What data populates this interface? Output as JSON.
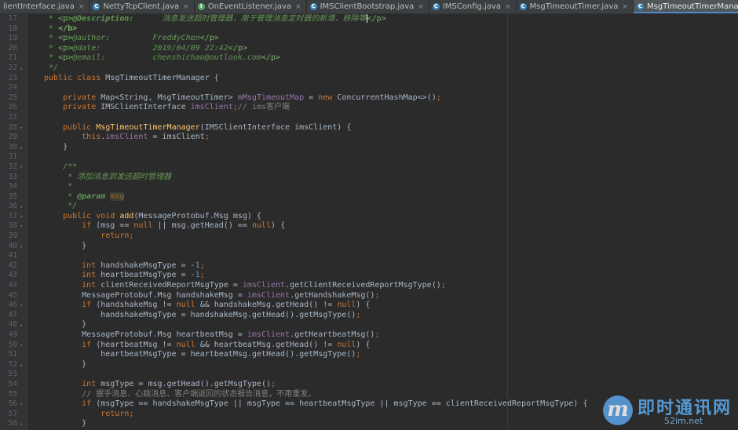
{
  "tabs": [
    {
      "label": "lientInterface.java",
      "icon": "none",
      "active": false
    },
    {
      "label": "NettyTcpClient.java",
      "icon": "class-icon",
      "active": false
    },
    {
      "label": "OnEventListener.java",
      "icon": "interface-icon",
      "active": false
    },
    {
      "label": "IMSClientBootstrap.java",
      "icon": "class-icon",
      "active": false
    },
    {
      "label": "IMSConfig.java",
      "icon": "class-icon",
      "active": false
    },
    {
      "label": "MsgTimeoutTimer.java",
      "icon": "class-icon",
      "active": false
    },
    {
      "label": "MsgTimeoutTimerManager.java",
      "icon": "class-icon",
      "active": true
    }
  ],
  "colors": {
    "background": "#2b2b2b",
    "keyword": "#cc7832",
    "field": "#9876aa",
    "method": "#ffc66d",
    "number": "#6897bb",
    "doc": "#629755",
    "tab_active_underline": "#4a88c7"
  },
  "editor": {
    "lines": [
      {
        "n": "17",
        "fold": "",
        "t": [
          [
            "dc",
            " * "
          ],
          [
            "tg",
            "<p>"
          ],
          [
            "ta",
            "@Description:"
          ],
          [
            "dc",
            "      消息发送超时管理器，用于管理消息定时器的新增、移除等"
          ],
          [
            "caret",
            ""
          ],
          [
            "tg",
            "</p>"
          ]
        ]
      },
      {
        "n": "18",
        "fold": "",
        "t": [
          [
            "dc",
            " * "
          ],
          [
            "tg2",
            "</b>"
          ]
        ]
      },
      {
        "n": "19",
        "fold": "",
        "t": [
          [
            "dc",
            " * "
          ],
          [
            "tg",
            "<p>"
          ],
          [
            "dc",
            "@author:         FreddyChen"
          ],
          [
            "tg",
            "</p>"
          ]
        ]
      },
      {
        "n": "20",
        "fold": "",
        "t": [
          [
            "dc",
            " * "
          ],
          [
            "tg",
            "<p>"
          ],
          [
            "dc",
            "@date:           2019/04/09 22:42"
          ],
          [
            "tg",
            "</p>"
          ]
        ]
      },
      {
        "n": "21",
        "fold": "",
        "t": [
          [
            "dc",
            " * "
          ],
          [
            "tg",
            "<p>"
          ],
          [
            "dc",
            "@email:          chenshichao@outlook.com"
          ],
          [
            "tg",
            "</p>"
          ]
        ]
      },
      {
        "n": "22",
        "fold": "▴",
        "t": [
          [
            "dc",
            " */"
          ]
        ]
      },
      {
        "n": "23",
        "fold": "",
        "t": [
          [
            "kw",
            "public class "
          ],
          [
            "tx",
            "MsgTimeoutTimerManager {"
          ]
        ]
      },
      {
        "n": "24",
        "fold": "",
        "t": []
      },
      {
        "n": "25",
        "fold": "",
        "t": [
          [
            "kw",
            "    private "
          ],
          [
            "tx",
            "Map<String, MsgTimeoutTimer> "
          ],
          [
            "fd",
            "mMsgTimeoutMap"
          ],
          [
            "tx",
            " = "
          ],
          [
            "kw",
            "new "
          ],
          [
            "tx",
            "ConcurrentHashMap<>()"
          ],
          [
            "kw",
            ";"
          ]
        ]
      },
      {
        "n": "26",
        "fold": "",
        "t": [
          [
            "kw",
            "    private "
          ],
          [
            "tx",
            "IMSClientInterface "
          ],
          [
            "fd",
            "imsClient"
          ],
          [
            "kw",
            ";"
          ],
          [
            "cm",
            "// ims客户端"
          ]
        ]
      },
      {
        "n": "27",
        "fold": "",
        "t": []
      },
      {
        "n": "28",
        "fold": "▾",
        "t": [
          [
            "kw",
            "    public "
          ],
          [
            "fn",
            "MsgTimeoutTimerManager"
          ],
          [
            "tx",
            "(IMSClientInterface imsClient) {"
          ]
        ]
      },
      {
        "n": "29",
        "fold": "",
        "t": [
          [
            "kw",
            "        this"
          ],
          [
            "tx",
            "."
          ],
          [
            "fd",
            "imsClient"
          ],
          [
            "tx",
            " = imsClient"
          ],
          [
            "kw",
            ";"
          ]
        ]
      },
      {
        "n": "30",
        "fold": "▴",
        "t": [
          [
            "tx",
            "    }"
          ]
        ]
      },
      {
        "n": "31",
        "fold": "",
        "t": []
      },
      {
        "n": "32",
        "fold": "▾",
        "t": [
          [
            "dc",
            "    /**"
          ]
        ]
      },
      {
        "n": "33",
        "fold": "",
        "t": [
          [
            "dc",
            "     * 添加消息到发送超时管理器"
          ]
        ]
      },
      {
        "n": "34",
        "fold": "",
        "t": [
          [
            "dc",
            "     *"
          ]
        ]
      },
      {
        "n": "35",
        "fold": "",
        "t": [
          [
            "dc",
            "     * "
          ],
          [
            "ta",
            "@param "
          ],
          [
            "pm",
            "msg"
          ]
        ]
      },
      {
        "n": "36",
        "fold": "▴",
        "t": [
          [
            "dc",
            "     */"
          ]
        ]
      },
      {
        "n": "37",
        "fold": "▾",
        "t": [
          [
            "kw",
            "    public void "
          ],
          [
            "fn",
            "add"
          ],
          [
            "tx",
            "(MessageProtobuf.Msg msg) {"
          ]
        ]
      },
      {
        "n": "38",
        "fold": "▾",
        "t": [
          [
            "kw",
            "        if "
          ],
          [
            "tx",
            "(msg == "
          ],
          [
            "kw",
            "null "
          ],
          [
            "tx",
            "|| msg.getHead() == "
          ],
          [
            "kw",
            "null"
          ],
          [
            "tx",
            ") {"
          ]
        ]
      },
      {
        "n": "39",
        "fold": "",
        "t": [
          [
            "kw",
            "            return;"
          ]
        ]
      },
      {
        "n": "40",
        "fold": "▴",
        "t": [
          [
            "tx",
            "        }"
          ]
        ]
      },
      {
        "n": "41",
        "fold": "",
        "t": []
      },
      {
        "n": "42",
        "fold": "",
        "t": [
          [
            "kw",
            "        int "
          ],
          [
            "tx",
            "handshakeMsgType = -"
          ],
          [
            "nu",
            "1"
          ],
          [
            "kw",
            ";"
          ]
        ]
      },
      {
        "n": "43",
        "fold": "",
        "t": [
          [
            "kw",
            "        int "
          ],
          [
            "tx",
            "heartbeatMsgType = -"
          ],
          [
            "nu",
            "1"
          ],
          [
            "kw",
            ";"
          ]
        ]
      },
      {
        "n": "44",
        "fold": "",
        "t": [
          [
            "kw",
            "        int "
          ],
          [
            "tx",
            "clientReceivedReportMsgType = "
          ],
          [
            "fd",
            "imsClient"
          ],
          [
            "tx",
            ".getClientReceivedReportMsgType()"
          ],
          [
            "kw",
            ";"
          ]
        ]
      },
      {
        "n": "45",
        "fold": "",
        "t": [
          [
            "tx",
            "        MessageProtobuf.Msg handshakeMsg = "
          ],
          [
            "fd",
            "imsClient"
          ],
          [
            "tx",
            ".getHandshakeMsg()"
          ],
          [
            "kw",
            ";"
          ]
        ]
      },
      {
        "n": "46",
        "fold": "▾",
        "t": [
          [
            "kw",
            "        if "
          ],
          [
            "tx",
            "(handshakeMsg != "
          ],
          [
            "kw",
            "null "
          ],
          [
            "tx",
            "&& handshakeMsg.getHead() != "
          ],
          [
            "kw",
            "null"
          ],
          [
            "tx",
            ") {"
          ]
        ]
      },
      {
        "n": "47",
        "fold": "",
        "t": [
          [
            "tx",
            "            handshakeMsgType = handshakeMsg.getHead().getMsgType()"
          ],
          [
            "kw",
            ";"
          ]
        ]
      },
      {
        "n": "48",
        "fold": "▴",
        "t": [
          [
            "tx",
            "        }"
          ]
        ]
      },
      {
        "n": "49",
        "fold": "",
        "t": [
          [
            "tx",
            "        MessageProtobuf.Msg heartbeatMsg = "
          ],
          [
            "fd",
            "imsClient"
          ],
          [
            "tx",
            ".getHeartbeatMsg()"
          ],
          [
            "kw",
            ";"
          ]
        ]
      },
      {
        "n": "50",
        "fold": "▾",
        "t": [
          [
            "kw",
            "        if "
          ],
          [
            "tx",
            "(heartbeatMsg != "
          ],
          [
            "kw",
            "null "
          ],
          [
            "tx",
            "&& heartbeatMsg.getHead() != "
          ],
          [
            "kw",
            "null"
          ],
          [
            "tx",
            ") {"
          ]
        ]
      },
      {
        "n": "51",
        "fold": "",
        "t": [
          [
            "tx",
            "            heartbeatMsgType = heartbeatMsg.getHead().getMsgType()"
          ],
          [
            "kw",
            ";"
          ]
        ]
      },
      {
        "n": "52",
        "fold": "▴",
        "t": [
          [
            "tx",
            "        }"
          ]
        ]
      },
      {
        "n": "53",
        "fold": "",
        "t": []
      },
      {
        "n": "54",
        "fold": "",
        "t": [
          [
            "kw",
            "        int "
          ],
          [
            "tx",
            "msgType = msg.getHead().getMsgType()"
          ],
          [
            "kw",
            ";"
          ]
        ]
      },
      {
        "n": "55",
        "fold": "",
        "t": [
          [
            "cm",
            "        // 握手消息、心跳消息、客户端返回的状态报告消息，不用重发。"
          ]
        ]
      },
      {
        "n": "56",
        "fold": "▾",
        "t": [
          [
            "kw",
            "        if "
          ],
          [
            "tx",
            "(msgType == handshakeMsgType || msgType == heartbeatMsgType || msgType == clientReceivedReportMsgType) {"
          ]
        ]
      },
      {
        "n": "57",
        "fold": "",
        "t": [
          [
            "kw",
            "            return;"
          ]
        ]
      },
      {
        "n": "58",
        "fold": "▴",
        "t": [
          [
            "tx",
            "        }"
          ]
        ]
      }
    ]
  },
  "watermark": {
    "logo": "m",
    "title": "即时通讯网",
    "url": "52im.net"
  }
}
